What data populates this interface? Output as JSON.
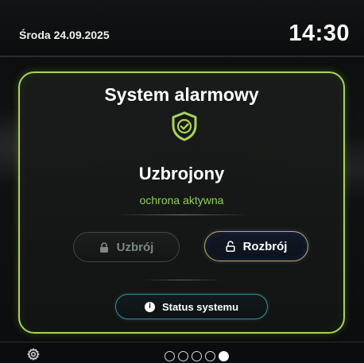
{
  "header": {
    "date": "Środa 24.09.2025",
    "time": "14:30"
  },
  "alarm": {
    "title": "System alarmowy",
    "status_icon": "shield-check-icon",
    "state": "Uzbrojony",
    "substate": "ochrona aktywna",
    "accent_color": "#a9d35a"
  },
  "buttons": {
    "arm_label": "Uzbrój",
    "arm_icon": "lock-icon",
    "disarm_label": "Rozbrój",
    "disarm_icon": "unlock-icon",
    "status_label": "Status systemu",
    "status_icon": "info-icon"
  },
  "footer": {
    "settings_icon": "gear-icon",
    "pages": [
      false,
      false,
      false,
      false,
      true
    ]
  }
}
